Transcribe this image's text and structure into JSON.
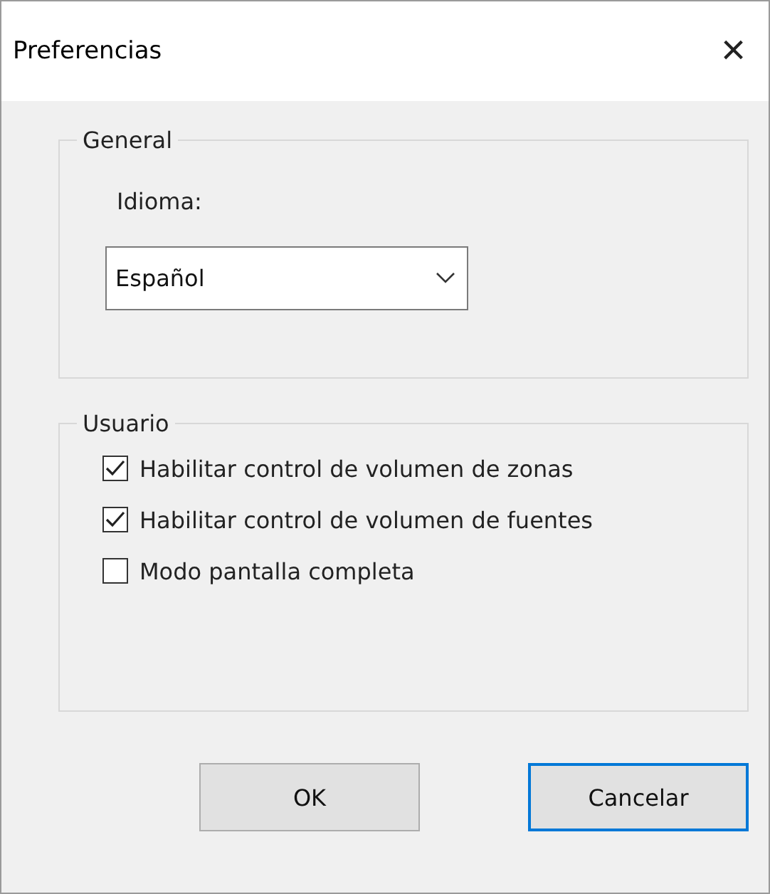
{
  "window": {
    "title": "Preferencias",
    "close": "×"
  },
  "general": {
    "title": "General",
    "language_label": "Idioma:",
    "language_value": "Español"
  },
  "user": {
    "title": "Usuario",
    "options": [
      {
        "label": "Habilitar control de volumen de zonas",
        "checked": true
      },
      {
        "label": "Habilitar control de volumen de fuentes",
        "checked": true
      },
      {
        "label": "Modo pantalla completa",
        "checked": false
      }
    ]
  },
  "buttons": [
    {
      "label": "OK",
      "focused": false
    },
    {
      "label": "Cancelar",
      "focused": true
    }
  ]
}
